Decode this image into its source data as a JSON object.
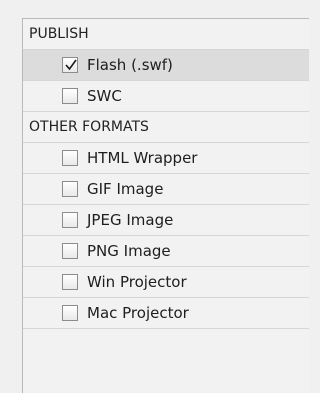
{
  "sections": {
    "publish": {
      "header": "PUBLISH",
      "items": [
        {
          "label": "Flash (.swf)",
          "checked": true
        },
        {
          "label": "SWC",
          "checked": false
        }
      ]
    },
    "other_formats": {
      "header": "OTHER FORMATS",
      "items": [
        {
          "label": "HTML Wrapper",
          "checked": false
        },
        {
          "label": "GIF Image",
          "checked": false
        },
        {
          "label": "JPEG Image",
          "checked": false
        },
        {
          "label": "PNG Image",
          "checked": false
        },
        {
          "label": "Win Projector",
          "checked": false
        },
        {
          "label": "Mac Projector",
          "checked": false
        }
      ]
    }
  },
  "colors": {
    "selected_row_bg": "#dcdcdc",
    "panel_bg": "#f2f2f2"
  }
}
